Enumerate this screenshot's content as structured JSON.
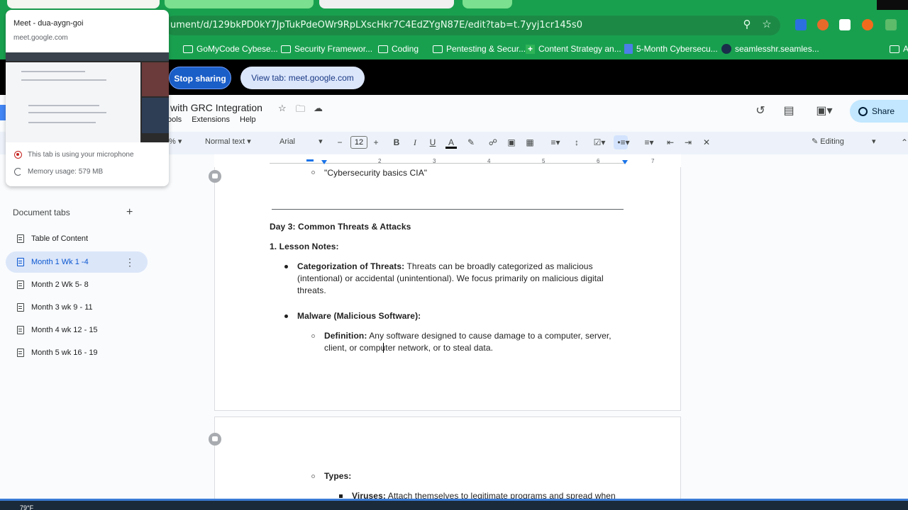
{
  "browser": {
    "url": "ument/d/129bkPD0kY7JpTukPdeOWr9RpLXscHkr7C4EdZYgN87E/edit?tab=t.7yyj1cr145s0",
    "bookmarks": [
      {
        "label": "GoMyCode Cybese...",
        "icon": "folder-icon"
      },
      {
        "label": "Security Framewor...",
        "icon": "folder-icon"
      },
      {
        "label": "Coding",
        "icon": "folder-icon"
      },
      {
        "label": "Pentesting & Secur...",
        "icon": "folder-icon"
      },
      {
        "label": "Content Strategy an...",
        "icon": "sheets-icon"
      },
      {
        "label": "5-Month Cybersecu...",
        "icon": "docs-icon"
      },
      {
        "label": "seamlesshr.seamles...",
        "icon": "site-icon"
      },
      {
        "label": "A",
        "icon": "folder-icon"
      }
    ]
  },
  "share_bar": {
    "stop_label": "Stop sharing",
    "view_label": "View tab: meet.google.com"
  },
  "tab_popup": {
    "title": "Meet - dua-aygn-goi",
    "url": "meet.google.com",
    "mic_status": "This tab is using your microphone",
    "memory": "Memory usage: 579 MB"
  },
  "docs": {
    "title": "with GRC Integration",
    "menus": [
      "ools",
      "Extensions",
      "Help"
    ],
    "share_label": "Share",
    "toolbar": {
      "zoom_fragment": "%",
      "style": "Normal text",
      "font": "Arial",
      "font_size": "12",
      "mode": "Editing"
    },
    "ruler_numbers": [
      "1",
      "2",
      "3",
      "4",
      "5",
      "6",
      "7"
    ]
  },
  "sidebar": {
    "heading": "Document tabs",
    "items": [
      {
        "label": "Table of Content",
        "selected": false
      },
      {
        "label": "Month 1 Wk 1 -4",
        "selected": true
      },
      {
        "label": "Month 2 Wk 5- 8",
        "selected": false
      },
      {
        "label": "Month 3 wk 9 - 11",
        "selected": false
      },
      {
        "label": "Month 4 wk 12 - 15",
        "selected": false
      },
      {
        "label": "Month 5 wk 16 - 19",
        "selected": false
      }
    ]
  },
  "content": {
    "prev_item": "\"Cybersecurity basics CIA\"",
    "day_heading": "Day 3: Common Threats & Attacks",
    "lesson_heading": "1. Lesson Notes:",
    "b1_term": "Categorization of Threats:",
    "b1_line1": "Threats can be broadly categorized as malicious",
    "b1_line2": "(intentional) or accidental (unintentional). We focus primarily on malicious digital",
    "b1_line3": "threats.",
    "b2_term": "Malware (Malicious Software):",
    "def_term": "Definition:",
    "def_line1": "Any software designed to cause damage to a computer, server,",
    "def_line2": "client, or computer network, or to steal data.",
    "types_term": "Types:",
    "virus_term": "Viruses:",
    "virus_text": "Attach themselves to legitimate programs and spread when"
  },
  "taskbar": {
    "temp": "79°F"
  }
}
